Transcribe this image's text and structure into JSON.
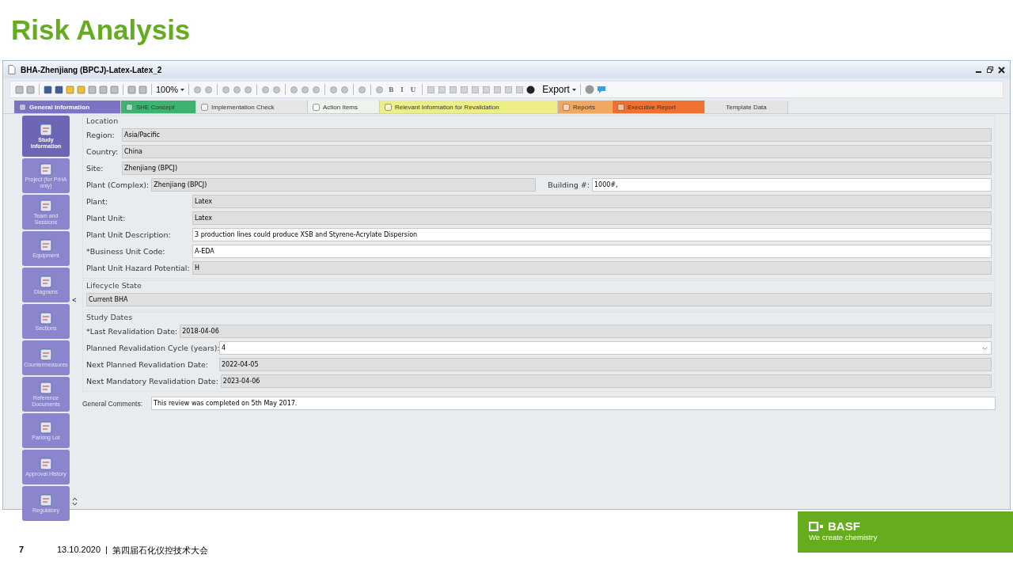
{
  "slide_title": "Risk Analysis",
  "window": {
    "title": "BHA-Zhenjiang (BPCJ)-Latex-Latex_2"
  },
  "toolbar": {
    "zoom": "100%",
    "export": "Export",
    "format": [
      "B",
      "I",
      "U"
    ]
  },
  "tabs": [
    {
      "label": "General Information",
      "selected": true,
      "color": "#7b74c4"
    },
    {
      "label": "SHE Concept",
      "selected": false,
      "color": "#3cb371"
    },
    {
      "label": "Implementation Check",
      "selected": false,
      "color": "#e6e6e6"
    },
    {
      "label": "Action Items",
      "selected": false,
      "color": "#eef3ee"
    },
    {
      "label": "Relevant Information for Revalidation",
      "selected": false,
      "color": "#eeee88"
    },
    {
      "label": "Reports",
      "selected": false,
      "color": "#f0a860"
    },
    {
      "label": "Executive Report",
      "selected": false,
      "color": "#f07030"
    },
    {
      "label": "Template Data",
      "selected": false,
      "color": "#e4e4e4"
    }
  ],
  "sidebar": {
    "items": [
      {
        "label": "Study Information",
        "selected": true
      },
      {
        "label": "Project (for PrHA only)",
        "selected": false
      },
      {
        "label": "Team and Sessions",
        "selected": false
      },
      {
        "label": "Equipment",
        "selected": false
      },
      {
        "label": "Diagrams",
        "selected": false
      },
      {
        "label": "Sections",
        "selected": false
      },
      {
        "label": "Countermeasures",
        "selected": false
      },
      {
        "label": "Reference Documents",
        "selected": false
      },
      {
        "label": "Parking Lot",
        "selected": false
      },
      {
        "label": "Approval History",
        "selected": false
      },
      {
        "label": "Regulatory",
        "selected": false
      }
    ],
    "collapse": "<"
  },
  "location": {
    "legend": "Location",
    "fields": [
      {
        "kind": "inline",
        "label": "Region:",
        "value": "Asia/Pacific",
        "editable": false
      },
      {
        "kind": "inline",
        "label": "Country:",
        "value": "China",
        "editable": false
      },
      {
        "kind": "inline",
        "label": "Site:",
        "value": "Zhenjiang (BPCJ)",
        "editable": false
      },
      {
        "kind": "pair",
        "label": "Plant (Complex):",
        "value": "Zhenjiang (BPCJ)",
        "editable": false,
        "extra_label": "Building #:",
        "extra_value": "1000#,"
      },
      {
        "kind": "aligned",
        "label": "Plant:",
        "value": "Latex",
        "editable": false
      },
      {
        "kind": "aligned",
        "label": "Plant Unit:",
        "value": "Latex",
        "editable": false
      },
      {
        "kind": "aligned",
        "label": "Plant Unit Description:",
        "value": "3 production lines could produce XSB and Styrene-Acrylate Dispersion",
        "editable": true
      },
      {
        "kind": "aligned",
        "label": "*Business Unit Code:",
        "value": "A-EDA",
        "editable": true
      },
      {
        "kind": "aligned",
        "label": "Plant Unit Hazard Potential:",
        "value": "H",
        "editable": false
      }
    ]
  },
  "lifecycle": {
    "legend": "Lifecycle State",
    "value": "Current BHA"
  },
  "study_dates": {
    "legend": "Study Dates",
    "fields": [
      {
        "kind": "inline",
        "label": "*Last Revalidation Date:",
        "value": "2018-04-06",
        "editable": false
      },
      {
        "kind": "dropdown",
        "label": "Planned Revalidation Cycle (years):",
        "value": "4",
        "editable": true
      },
      {
        "kind": "aligned",
        "label": "Next Planned Revalidation Date:",
        "value": "2022-04-05",
        "editable": false
      },
      {
        "kind": "aligned",
        "label": "Next Mandatory Revalidation Date:",
        "value": "2023-04-06",
        "editable": false
      }
    ]
  },
  "comments": {
    "label": "General Comments:",
    "value": "This review was completed on 5th May 2017."
  },
  "footer": {
    "page": "7",
    "date": "13.10.2020",
    "separator": "|",
    "event": "第四届石化仪控技术大会",
    "logo": "BASF",
    "tagline": "We create chemistry"
  }
}
